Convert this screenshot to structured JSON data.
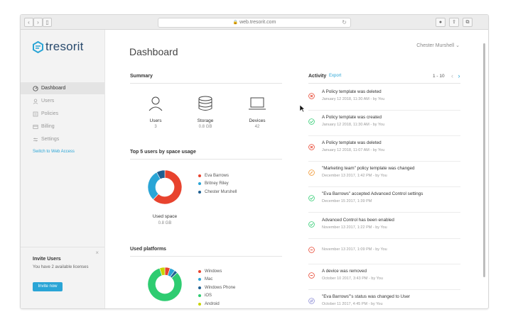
{
  "browser": {
    "url": "web.tresorit.com",
    "back": "‹",
    "forward": "›",
    "sidebar_toggle": "▯"
  },
  "app": {
    "logo_text": "tresorit"
  },
  "sidebar": {
    "items": [
      {
        "label": "Dashboard",
        "icon": "dashboard-icon"
      },
      {
        "label": "Users",
        "icon": "users-icon"
      },
      {
        "label": "Policies",
        "icon": "policies-icon"
      },
      {
        "label": "Billing",
        "icon": "billing-icon"
      },
      {
        "label": "Settings",
        "icon": "settings-icon"
      }
    ],
    "switch_link": "Switch to Web Access",
    "invite": {
      "title": "Invite Users",
      "description": "You have 2 available licenses",
      "button": "Invite now",
      "close": "×"
    }
  },
  "header": {
    "title": "Dashboard",
    "user": "Chester Murshell"
  },
  "summary": {
    "title": "Summary",
    "stats": [
      {
        "label": "Users",
        "value": "3",
        "icon": "user-icon"
      },
      {
        "label": "Storage",
        "value": "0.8 GB",
        "icon": "database-icon"
      },
      {
        "label": "Devices",
        "value": "42",
        "icon": "laptop-icon"
      }
    ]
  },
  "top_users": {
    "title": "Top 5 users by space usage",
    "center_label": "Used space",
    "center_value": "0.8 GB",
    "legend": [
      {
        "name": "Eva Barrows",
        "color": "#e8432e"
      },
      {
        "name": "Britney Riley",
        "color": "#2aa5d6"
      },
      {
        "name": "Chester Murshell",
        "color": "#1f5f91"
      }
    ]
  },
  "platforms": {
    "title": "Used platforms",
    "legend": [
      {
        "name": "Windows",
        "color": "#e8432e"
      },
      {
        "name": "Mac",
        "color": "#2aa5d6"
      },
      {
        "name": "Windows Phone",
        "color": "#1f5f91"
      },
      {
        "name": "iOS",
        "color": "#2ecc71"
      },
      {
        "name": "Android",
        "color": "#c8d400"
      }
    ]
  },
  "chart_data": [
    {
      "type": "pie",
      "title": "Top 5 users by space usage",
      "categories": [
        "Eva Barrows",
        "Britney Riley",
        "Chester Murshell"
      ],
      "values": [
        62,
        30,
        8
      ]
    },
    {
      "type": "pie",
      "title": "Used platforms",
      "categories": [
        "Windows",
        "Mac",
        "Windows Phone",
        "iOS",
        "Android"
      ],
      "values": [
        5,
        5,
        3,
        82,
        5
      ]
    }
  ],
  "activity": {
    "title": "Activity",
    "export": "Export",
    "page": "1 - 10",
    "prev": "‹",
    "next": "›",
    "items": [
      {
        "text": "A Policy template was deleted",
        "meta": "January 12 2018, 11:30 AM - by You",
        "status": "deleted",
        "color": "#e8432e"
      },
      {
        "text": "A Policy template was created",
        "meta": "January 12 2018, 11:30 AM - by You",
        "status": "created",
        "color": "#2ecc71"
      },
      {
        "text": "A Policy template was deleted",
        "meta": "January 12 2018, 11:07 AM - by You",
        "status": "deleted",
        "color": "#e8432e"
      },
      {
        "text": "\"Marketing team\" policy template was changed",
        "meta": "December 13 2017, 1:42 PM - by You",
        "status": "changed",
        "color": "#f0932b"
      },
      {
        "text": "\"Eva Barrows\" accepted Advanced Control settings",
        "meta": "December 15 2017, 1:39 PM",
        "status": "accepted",
        "color": "#2ecc71"
      },
      {
        "text": "Advanced Control has been enabled",
        "meta": "November 13 2017, 1:22 PM - by You",
        "status": "enabled",
        "color": "#2ecc71"
      },
      {
        "text": "",
        "meta": "November 13 2017, 1:09 PM - by You",
        "status": "removed",
        "color": "#e8432e"
      },
      {
        "text": "A device was removed",
        "meta": "October 10 2017, 3:43 PM - by You",
        "status": "removed",
        "color": "#e8432e"
      },
      {
        "text": "\"Eva Barrows\"'s status was changed to User",
        "meta": "October 11 2017, 4:45 PM - by You",
        "status": "status",
        "color": "#8e8ed6"
      }
    ]
  }
}
